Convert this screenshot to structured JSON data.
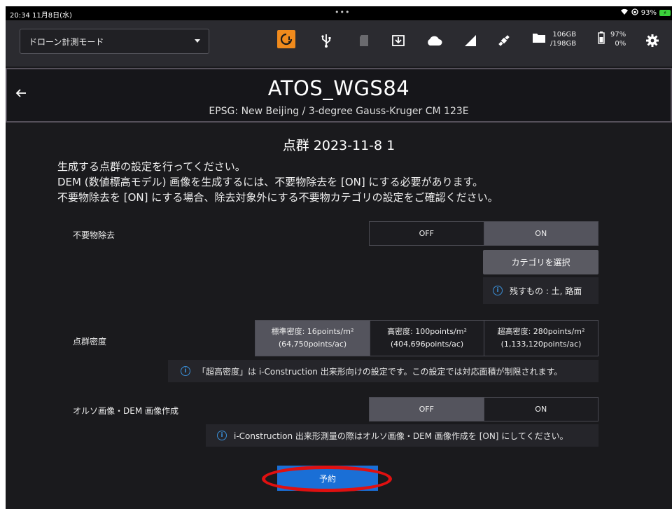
{
  "status_bar": {
    "time": "20:34  11月8日(水)",
    "dots": "•••",
    "battery_percent": "93%"
  },
  "toolbar": {
    "mode_select": "ドローン計測モード",
    "storage_used": "106GB",
    "storage_total": "/198GB",
    "battery_top": "97%",
    "battery_bottom": "0%",
    "icons": [
      "alert-icon",
      "usb-icon",
      "sd-card-icon",
      "download-icon",
      "cloud-icon",
      "signal-icon",
      "satellite-icon",
      "folder-icon",
      "battery-icon",
      "gear-icon"
    ]
  },
  "header": {
    "title": "ATOS_WGS84",
    "subtitle": "EPSG: New Beijing / 3-degree Gauss-Kruger CM 123E"
  },
  "main": {
    "title": "点群 2023-11-8 1",
    "desc_line1": "生成する点群の設定を行ってください。",
    "desc_line2": "DEM (数値標高モデル) 画像を生成するには、不要物除去を [ON] にする必要があります。",
    "desc_line3": "不要物除去を [ON] にする場合、除去対象外にする不要物カテゴリの設定をご確認ください。"
  },
  "noise_removal": {
    "label": "不要物除去",
    "off": "OFF",
    "on": "ON",
    "selected": "ON",
    "category_button": "カテゴリを選択",
    "info": "残すもの : 土, 路面"
  },
  "density": {
    "label": "点群密度",
    "options": [
      {
        "line1": "標準密度: 16points/m²",
        "line2": "(64,750points/ac)"
      },
      {
        "line1": "高密度: 100points/m²",
        "line2": "(404,696points/ac)"
      },
      {
        "line1": "超高密度: 280points/m²",
        "line2": "(1,133,120points/ac)"
      }
    ],
    "selected_index": 0,
    "info": "「超高密度」は i-Construction 出来形向けの設定です。この設定では対応面積が制限されます。"
  },
  "ortho_dem": {
    "label": "オルソ画像・DEM 画像作成",
    "off": "OFF",
    "on": "ON",
    "selected": "OFF",
    "info": "i-Construction 出来形測量の際はオルソ画像・DEM 画像作成を [ON] にしてください。"
  },
  "reserve_button": "予約",
  "colors": {
    "accent_orange": "#f08a1c",
    "primary_blue": "#1a6fd6",
    "info_blue": "#3a8fd8",
    "highlight_red": "#e01010"
  }
}
